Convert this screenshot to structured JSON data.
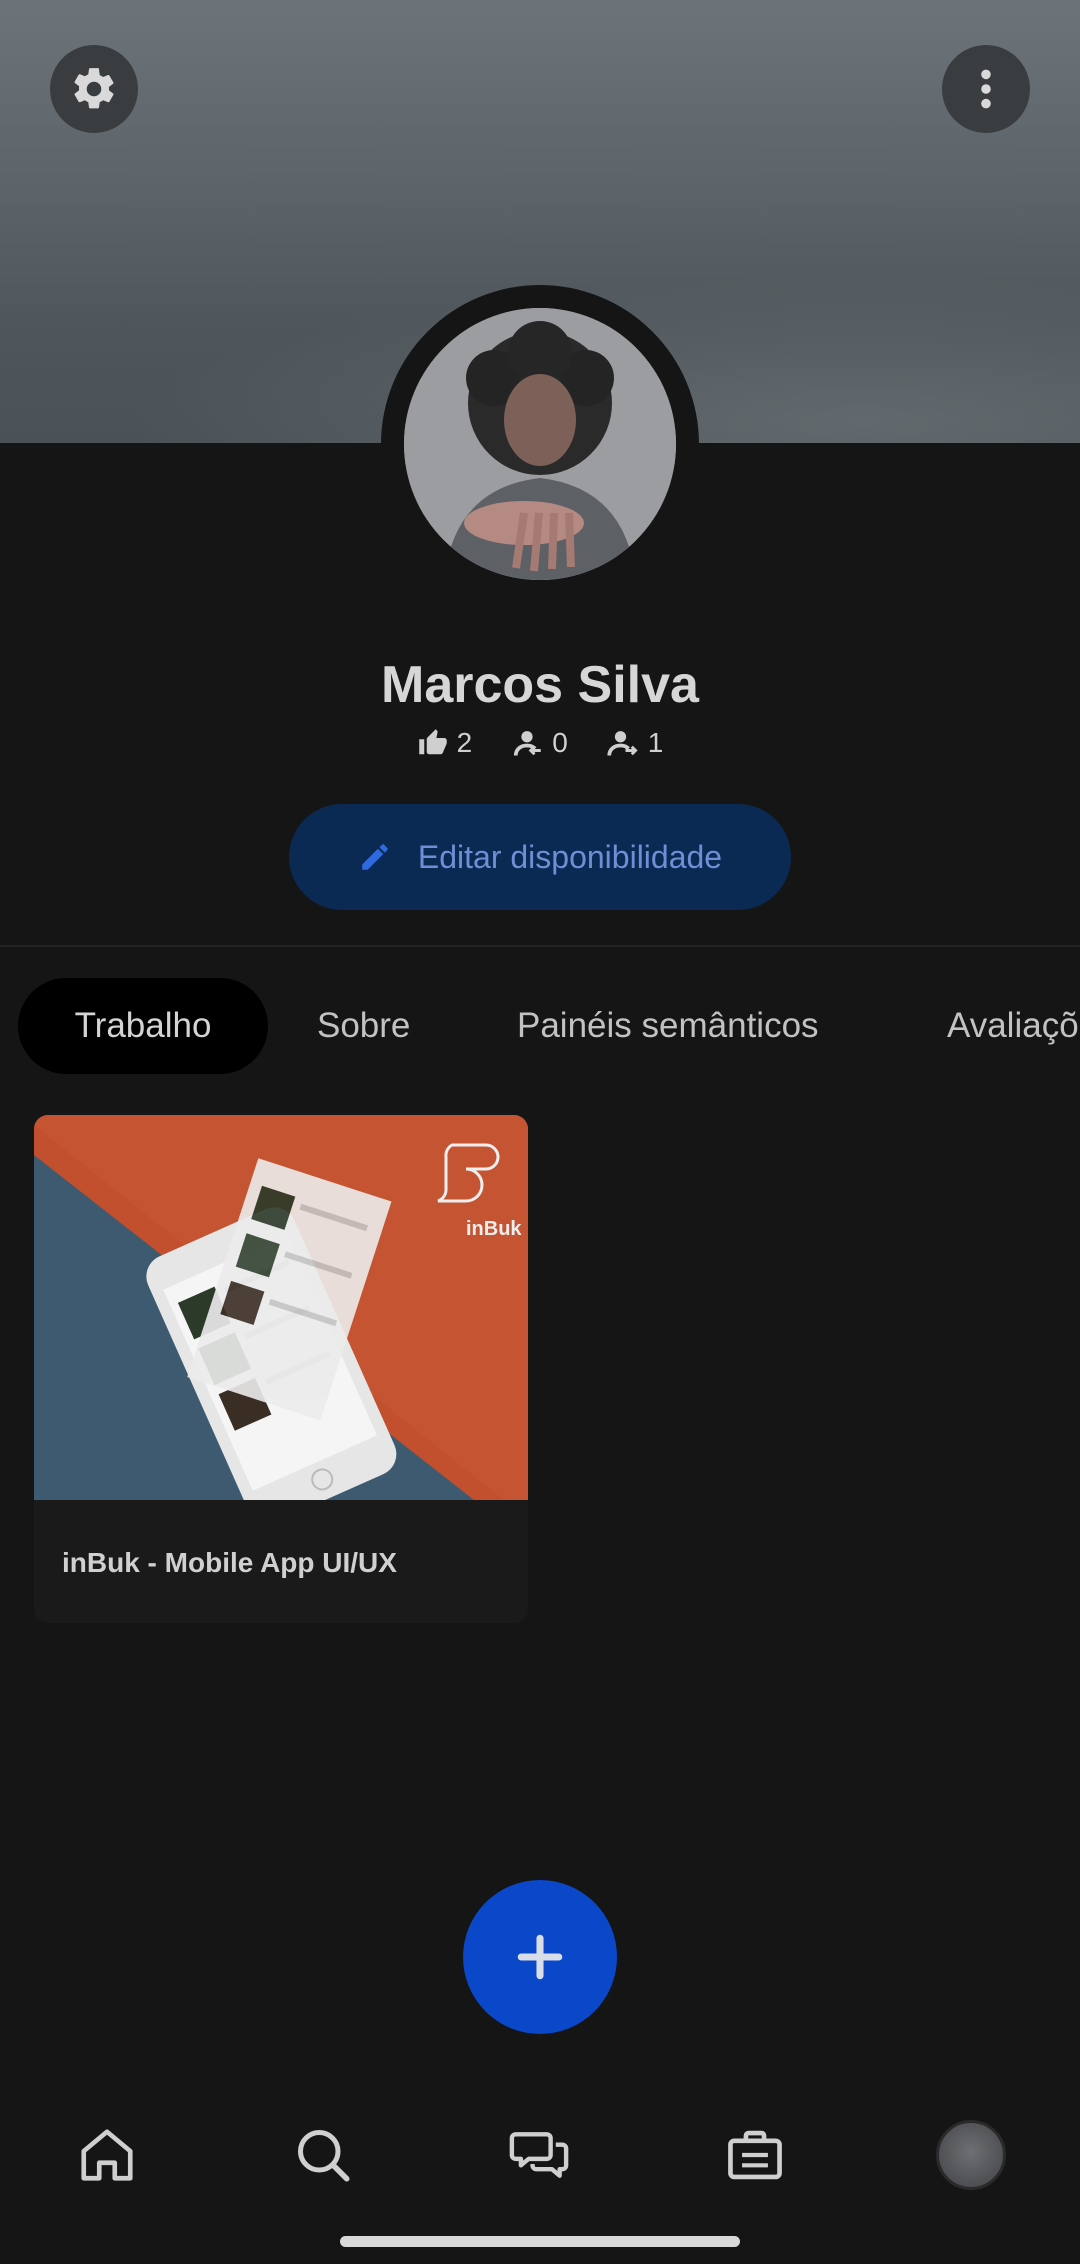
{
  "profile": {
    "name": "Marcos Silva",
    "stats": {
      "likes": "2",
      "followers": "0",
      "following": "1"
    },
    "edit_button_label": "Editar disponibilidade"
  },
  "tabs": [
    {
      "label": "Trabalho",
      "active": true
    },
    {
      "label": "Sobre",
      "active": false
    },
    {
      "label": "Painéis semânticos",
      "active": false
    },
    {
      "label": "Avaliações",
      "active": false
    }
  ],
  "projects": [
    {
      "title": "inBuk - Mobile App UI/UX",
      "logo_text": "inBuk"
    }
  ],
  "colors": {
    "background": "#151515",
    "accent": "#0a47c9",
    "edit_button_bg": "#0a2a54",
    "edit_button_text": "#6f8ed6"
  },
  "icons": {
    "top_left": "gear-icon",
    "top_right": "more-vertical-icon",
    "fab": "plus-icon",
    "nav": [
      "home-icon",
      "search-icon",
      "chat-icon",
      "briefcase-icon",
      "avatar"
    ]
  }
}
